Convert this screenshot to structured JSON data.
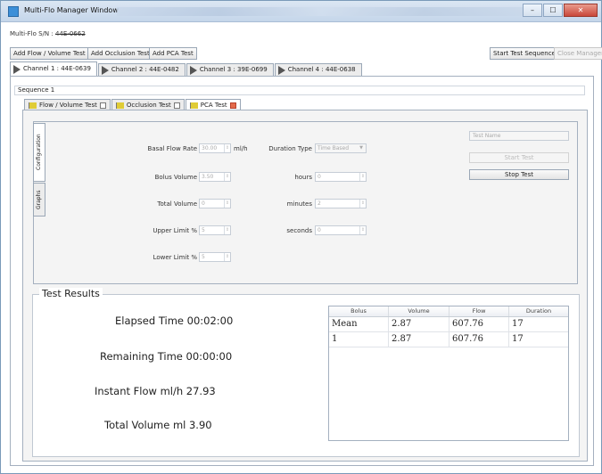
{
  "window": {
    "title": "Multi-Flo Manager Window",
    "controls": [
      "–",
      "☐",
      "✕"
    ]
  },
  "serial": {
    "label": "Multi-Flo S/N :",
    "value": "44E-0662"
  },
  "toolbar": {
    "add_flow": "Add Flow / Volume Test",
    "add_occlusion": "Add Occlusion Test",
    "add_pca": "Add PCA Test",
    "start_sequence": "Start Test Sequence",
    "close_manager": "Close Manager"
  },
  "channel_tabs": [
    {
      "label": "Channel 1 : 44E-0639"
    },
    {
      "label": "Channel 2 : 44E-0482"
    },
    {
      "label": "Channel 3 : 39E-0699"
    },
    {
      "label": "Channel 4 : 44E-0638"
    }
  ],
  "sequence": {
    "label": "Sequence 1"
  },
  "test_tabs": [
    {
      "label": "Flow / Volume Test"
    },
    {
      "label": "Occlusion Test"
    },
    {
      "label": "PCA Test"
    }
  ],
  "side_tabs": {
    "configuration": "Configuration",
    "graphs": "Graphs"
  },
  "config": {
    "basal_label": "Basal Flow Rate",
    "basal_value": "30.00",
    "basal_unit": "ml/h",
    "bolus_label": "Bolus Volume",
    "bolus_value": "3.50",
    "total_label": "Total Volume",
    "total_value": "0",
    "upper_label": "Upper Limit %",
    "upper_value": "5",
    "lower_label": "Lower Limit %",
    "lower_value": "5",
    "duration_type_label": "Duration Type",
    "duration_type_value": "Time Based",
    "hours_label": "hours",
    "hours_value": "0",
    "minutes_label": "minutes",
    "minutes_value": "2",
    "seconds_label": "seconds",
    "seconds_value": "0",
    "test_name_placeholder": "Test Name",
    "start_test": "Start Test",
    "stop_test": "Stop Test"
  },
  "results": {
    "title": "Test Results",
    "elapsed": "Elapsed Time 00:02:00",
    "remaining": "Remaining Time 00:00:00",
    "instant_flow": "Instant Flow ml/h 27.93",
    "total_volume": "Total Volume ml 3.90",
    "table": {
      "headers": [
        "Bolus",
        "Volume",
        "Flow",
        "Duration"
      ],
      "rows": [
        [
          "Mean",
          "2.87",
          "607.76",
          "17"
        ],
        [
          "1",
          "2.87",
          "607.76",
          "17"
        ]
      ]
    }
  }
}
